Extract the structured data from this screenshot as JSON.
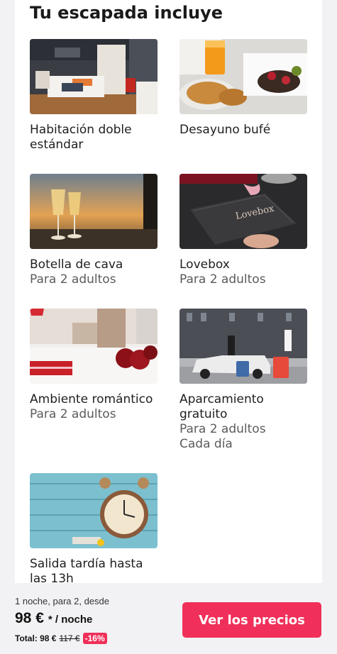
{
  "section": {
    "title": "Tu escapada incluye"
  },
  "items": [
    {
      "title": "Habitación doble estándar",
      "sub1": "",
      "sub2": ""
    },
    {
      "title": "Desayuno bufé",
      "sub1": "",
      "sub2": ""
    },
    {
      "title": "Botella de cava",
      "sub1": "Para 2 adultos",
      "sub2": ""
    },
    {
      "title": "Lovebox",
      "sub1": "Para 2 adultos",
      "sub2": "",
      "box_text": "Lovebox"
    },
    {
      "title": "Ambiente romántico",
      "sub1": "Para 2 adultos",
      "sub2": ""
    },
    {
      "title": "Aparcamiento gratuito",
      "sub1": "Para 2 adultos",
      "sub2": "Cada día"
    },
    {
      "title": "Salida tardía hasta las 13h",
      "sub1": "",
      "sub2": ""
    }
  ],
  "footer": {
    "description": "1 noche, para 2, desde",
    "price": "98 €",
    "price_unit": "* / noche",
    "total_label": "Total: 98 €",
    "old_price": "117 €",
    "discount": "-16%",
    "cta_label": "Ver los precios"
  },
  "colors": {
    "accent": "#f0305a",
    "background": "#f2f2f4"
  }
}
